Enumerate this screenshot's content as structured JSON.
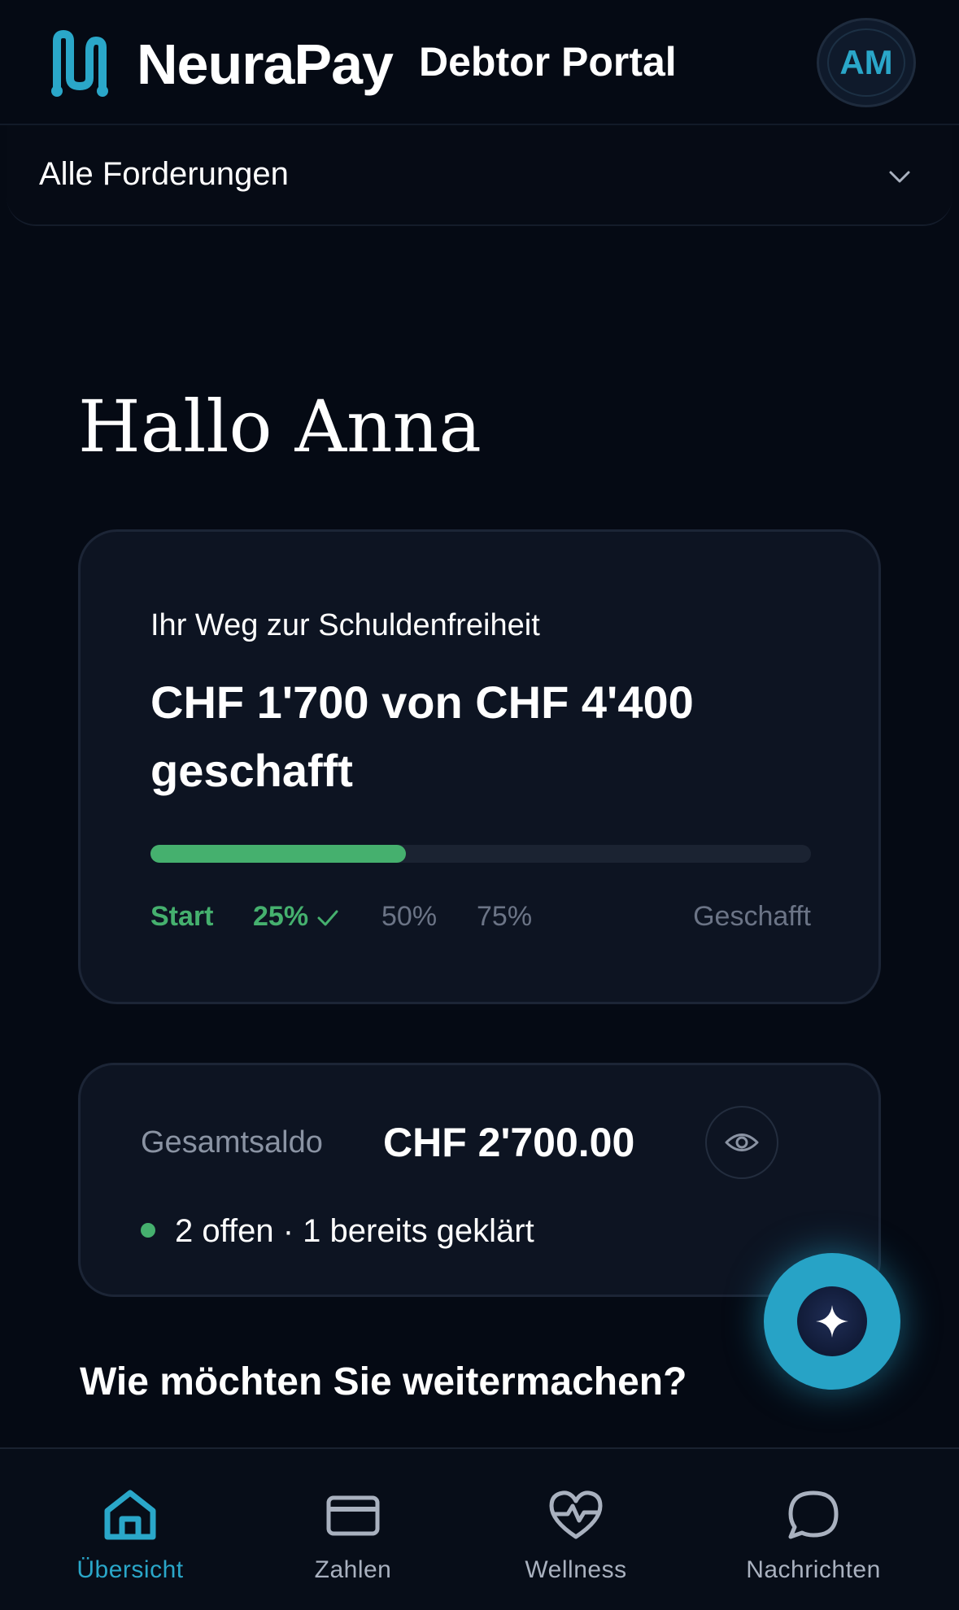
{
  "header": {
    "brand": "NeuraPay",
    "subtitle": "Debtor Portal",
    "avatar_initials": "AM"
  },
  "filter": {
    "selected": "Alle Forderungen"
  },
  "greeting": "Hallo Anna",
  "progress": {
    "eyebrow": "Ihr Weg zur Schuldenfreiheit",
    "headline": "CHF 1'700 von CHF 4'400 geschafft",
    "paid": 1700,
    "total": 4400,
    "milestones": [
      {
        "label": "Start",
        "reached": true
      },
      {
        "label": "25%",
        "reached": true
      },
      {
        "label": "50%",
        "reached": false
      },
      {
        "label": "75%",
        "reached": false
      },
      {
        "label": "Geschafft",
        "reached": false
      }
    ]
  },
  "balance": {
    "label": "Gesamtsaldo",
    "value": "CHF 2'700.00",
    "status": "2 offen · 1 bereits geklärt"
  },
  "question": "Wie möchten Sie weitermachen?",
  "nav": {
    "items": [
      {
        "label": "Übersicht",
        "icon": "home-icon",
        "active": true
      },
      {
        "label": "Zahlen",
        "icon": "card-icon",
        "active": false
      },
      {
        "label": "Wellness",
        "icon": "heart-pulse-icon",
        "active": false
      },
      {
        "label": "Nachrichten",
        "icon": "chat-icon",
        "active": false
      }
    ]
  },
  "colors": {
    "accent": "#2aa7c9",
    "success": "#45b06e",
    "background": "#050a14",
    "card": "#0d1422"
  }
}
